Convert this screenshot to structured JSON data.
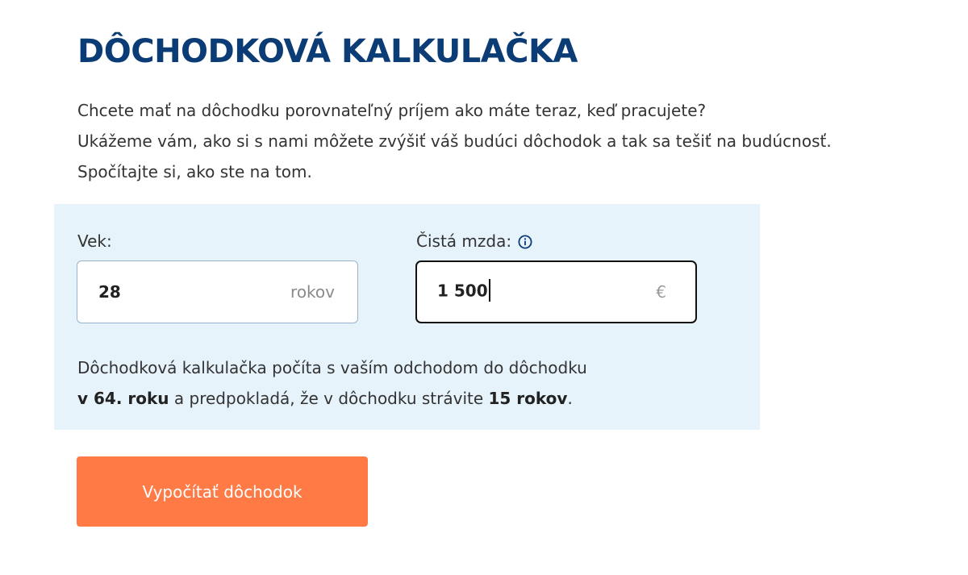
{
  "header": {
    "title": "DÔCHODKOVÁ KALKULAČKA"
  },
  "intro": {
    "lines": [
      "Chcete mať na dôchodku porovnateľný príjem ako máte teraz, keď pracujete?",
      "Ukážeme vám, ako si s nami môžete zvýšiť váš budúci dôchodok a tak sa tešiť na budúcnosť.",
      "Spočítajte si, ako ste na tom."
    ]
  },
  "form": {
    "age": {
      "label": "Vek:",
      "value": "28",
      "unit": "rokov"
    },
    "salary": {
      "label": "Čistá mzda:",
      "value": "1 500",
      "unit": "€",
      "info_icon": "info-circle-icon"
    },
    "note": {
      "line1": "Dôchodková kalkulačka počíta s vaším odchodom do dôchodku",
      "retirement_age": "v 64. roku",
      "middle": " a predpokladá, že v dôchodku strávite ",
      "retirement_years": "15 rokov",
      "end": "."
    }
  },
  "actions": {
    "calculate_label": "Vypočítať dôchodok"
  },
  "colors": {
    "title": "#0b3c75",
    "panel_background": "#e6f3fb",
    "button": "#ff7a45"
  }
}
